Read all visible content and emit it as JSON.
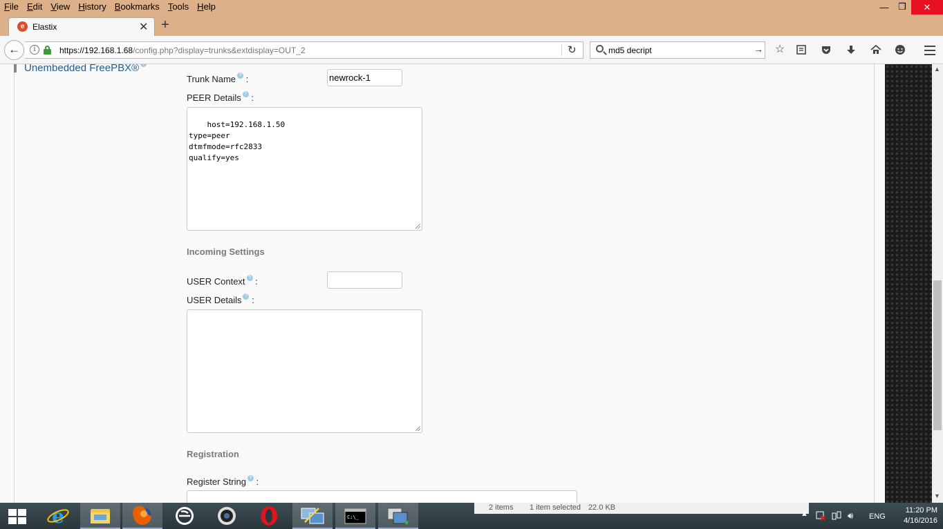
{
  "menu": [
    "File",
    "Edit",
    "View",
    "History",
    "Bookmarks",
    "Tools",
    "Help"
  ],
  "window": {
    "minimize": "—",
    "maximize": "❐",
    "close": "✕"
  },
  "tab": {
    "title": "Elastix",
    "favicon_letter": "e",
    "close": "✕",
    "new_tab": "+"
  },
  "nav": {
    "back": "←",
    "url_host": "https://192.168.1.68",
    "url_path": "/config.php?display=trunks&extdisplay=OUT_2",
    "reload": "↻",
    "search_value": "md5 decript",
    "search_go": "→",
    "icons": [
      "bookmark-star-icon",
      "reading-list-icon",
      "pocket-icon",
      "downloads-icon",
      "home-icon",
      "hello-chat-icon",
      "menu-icon"
    ]
  },
  "sidebar": {
    "link": "Unembedded FreePBX®"
  },
  "form": {
    "trunk_name_label": "Trunk Name",
    "trunk_name_value": "newrock-1",
    "peer_details_label": "PEER Details",
    "peer_details_value": "host=192.168.1.50\ntype=peer\ndtmfmode=rfc2833\nqualify=yes",
    "incoming_heading": "Incoming Settings",
    "user_context_label": "USER Context",
    "user_context_value": "",
    "user_details_label": "USER Details",
    "user_details_value": "",
    "registration_heading": "Registration",
    "register_string_label": "Register String",
    "register_string_value": "",
    "colon": ":",
    "help_glyph": "?"
  },
  "explorer_status": {
    "items": "2 items",
    "selected": "1 item selected",
    "size": "22.0 KB"
  },
  "tray": {
    "language": "ENG",
    "time": "11:20 PM",
    "date": "4/16/2016"
  },
  "colors": {
    "titlebar": "#dcb089",
    "close_red": "#e81123",
    "link_blue": "#215e8e",
    "lock_green": "#3a9b3a"
  }
}
